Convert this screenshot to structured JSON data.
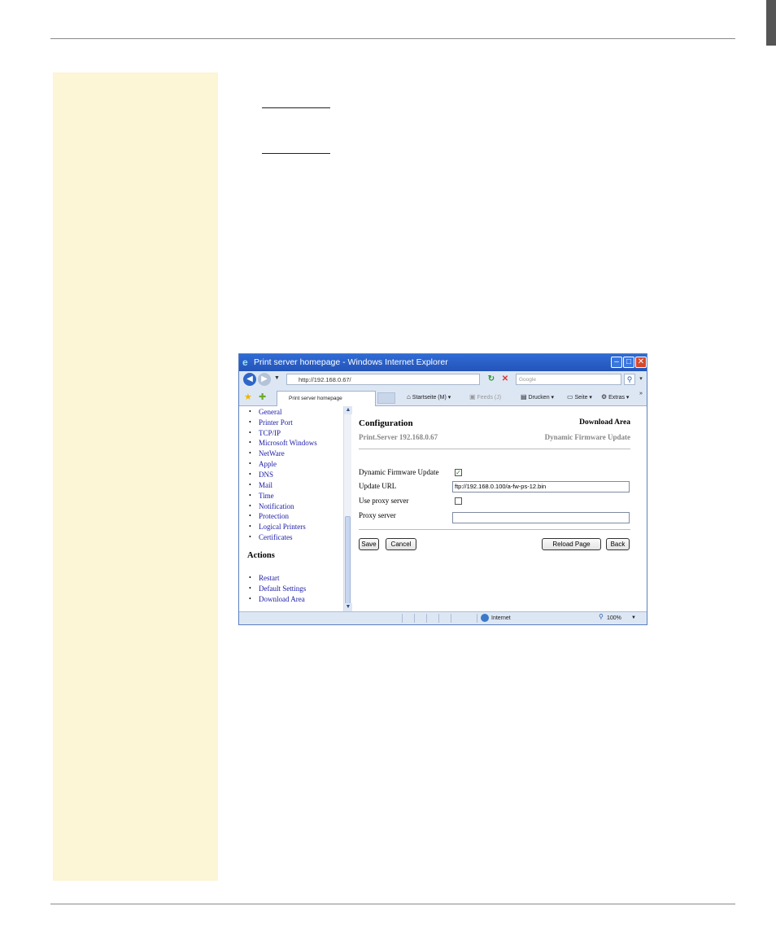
{
  "window": {
    "title": "Print server homepage - Windows Internet Explorer",
    "buttons": {
      "min": "–",
      "max": "□",
      "close": "✕"
    }
  },
  "address_bar": {
    "url": "http://192.168.0.67/",
    "search_placeholder": "Google"
  },
  "tab_bar": {
    "tab_label": "Print server homepage",
    "commands": {
      "home": "Startseite (M)",
      "feeds": "Feeds (J)",
      "print": "Drucken",
      "page": "Seite",
      "tools": "Extras"
    }
  },
  "left_nav": {
    "items": [
      "General",
      "Printer Port",
      "TCP/IP",
      "Microsoft Windows",
      "NetWare",
      "Apple",
      "DNS",
      "Mail",
      "Time",
      "Notification",
      "Protection",
      "Logical Printers",
      "Certificates"
    ],
    "actions_heading": "Actions",
    "actions": [
      "Restart",
      "Default Settings",
      "Download Area"
    ]
  },
  "main": {
    "title": "Configuration",
    "right_title": "Download Area",
    "subtitle": "Print.Server 192.168.0.67",
    "right_subtitle": "Dynamic Firmware Update",
    "fields": {
      "dfu_label": "Dynamic Firmware Update",
      "dfu_checked": true,
      "update_url_label": "Update URL",
      "update_url_value": "ftp://192.168.0.100/a-fw-ps-12.bin",
      "proxy_use_label": "Use proxy server",
      "proxy_use_checked": false,
      "proxy_server_label": "Proxy server",
      "proxy_server_value": ""
    },
    "buttons": {
      "save": "Save",
      "cancel": "Cancel",
      "reload": "Reload Page",
      "back": "Back"
    }
  },
  "status_bar": {
    "zone": "Internet",
    "zoom": "100%"
  }
}
